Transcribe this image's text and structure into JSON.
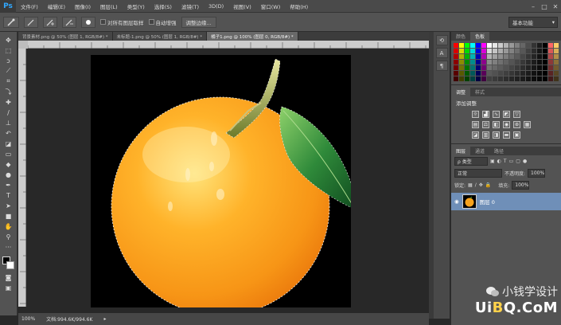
{
  "app": {
    "logo": "Ps"
  },
  "menu": [
    "文件(F)",
    "编辑(E)",
    "图像(I)",
    "图层(L)",
    "类型(Y)",
    "选择(S)",
    "滤镜(T)",
    "3D(D)",
    "视图(V)",
    "窗口(W)",
    "帮助(H)"
  ],
  "window_controls": [
    "–",
    "□",
    "✕"
  ],
  "options": {
    "sample_all_layers": "对所有图层取样",
    "auto_enhance": "自动增强",
    "refine_edge": "调整边缘...",
    "workspace": "基本功能"
  },
  "tabs": [
    {
      "label": "背景素材.png @ 50% (图层 1, RGB/8#) *"
    },
    {
      "label": "未标题-1.png @ 50% (图层 1, RGB/8#) *"
    },
    {
      "label": "橘子1.png @ 100% (图层 0, RGB/8#) *",
      "active": true
    }
  ],
  "status": {
    "zoom": "100%",
    "doc_info": "文档:994.6K/994.6K"
  },
  "panels": {
    "color_tabs": [
      "颜色",
      "色板"
    ],
    "adjust_tabs": [
      "调整",
      "样式"
    ],
    "adjust_title": "添加调整",
    "layers_tabs": [
      "图层",
      "通道",
      "路径"
    ],
    "kind": "ρ 类型",
    "blend_mode": "正常",
    "opacity_label": "不透明度:",
    "opacity_value": "100%",
    "lock_label": "锁定:",
    "fill_label": "填充:",
    "fill_value": "100%",
    "layer_name": "图层 0"
  },
  "watermark": {
    "line1": "小钱学设计",
    "line2_a": "Ui",
    "line2_b": "B",
    "line2_c": "Q.CoM"
  },
  "icons": [
    "brush-tool-icon",
    "move-tool-icon",
    "marquee-tool-icon",
    "lasso-tool-icon",
    "quick-select-tool-icon",
    "crop-tool-icon",
    "eyedropper-tool-icon",
    "healing-tool-icon",
    "brush-icon",
    "stamp-tool-icon",
    "history-brush-icon",
    "eraser-tool-icon",
    "gradient-tool-icon",
    "blur-tool-icon",
    "dodge-tool-icon",
    "pen-tool-icon",
    "type-tool-icon",
    "path-select-icon",
    "shape-tool-icon",
    "hand-tool-icon",
    "zoom-tool-icon",
    "eye-icon",
    "wechat-icon"
  ],
  "swatch_colors": [
    "#ff0000",
    "#ffff00",
    "#00ff00",
    "#00ffff",
    "#0000ff",
    "#ff00ff",
    "#ffffff",
    "#e6e6e6",
    "#cccccc",
    "#b3b3b3",
    "#999999",
    "#808080",
    "#666666",
    "#4d4d4d",
    "#333333",
    "#1a1a1a",
    "#000000",
    "#ff6666",
    "#ffcc66"
  ]
}
